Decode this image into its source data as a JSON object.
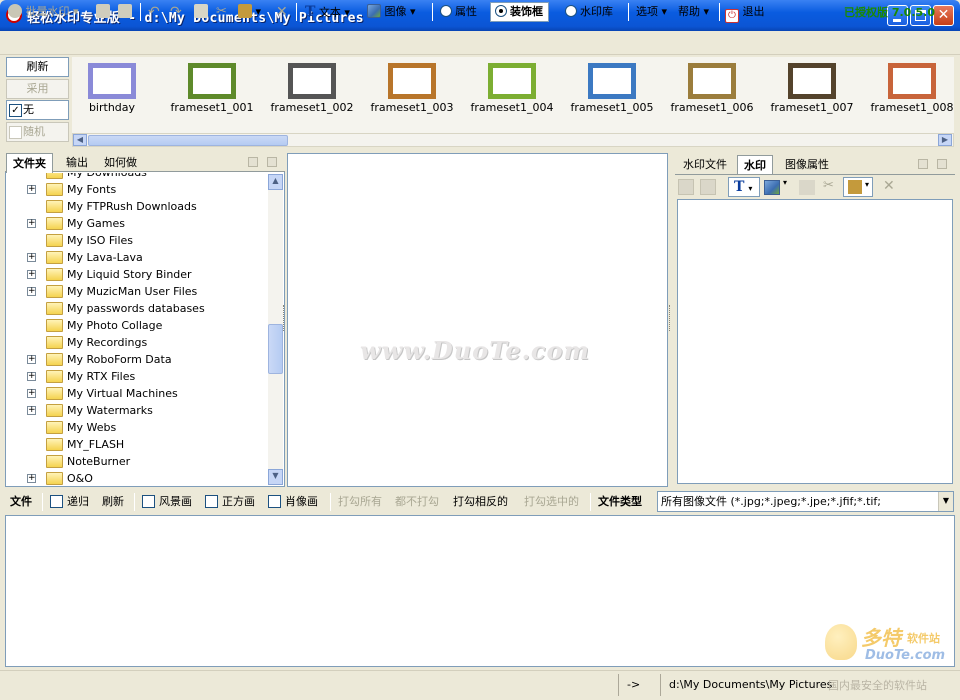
{
  "window": {
    "title": "轻松水印专业版 - d:\\My Documents\\My Pictures",
    "icon": "app-logo-icon"
  },
  "toolbar": {
    "batch_watermark": "批量水印",
    "text": "文本",
    "image": "图像",
    "properties": "属性",
    "decoration_frame": "装饰框",
    "watermark_lib": "水印库",
    "options": "选项",
    "help": "帮助",
    "exit": "退出",
    "license": "已授权版 7.0.5.0",
    "active_mode": "decoration_frame"
  },
  "gallery": {
    "refresh": "刷新",
    "apply": "采用",
    "none": "无",
    "none_checked": true,
    "random": "随机",
    "random_checked": false,
    "frames": [
      {
        "label": "birthday",
        "color": "#8a8ad8"
      },
      {
        "label": "frameset1_001",
        "color": "#5e8a2a"
      },
      {
        "label": "frameset1_002",
        "color": "#555555"
      },
      {
        "label": "frameset1_003",
        "color": "#b8752a"
      },
      {
        "label": "frameset1_004",
        "color": "#7cae32"
      },
      {
        "label": "frameset1_005",
        "color": "#3c79c2"
      },
      {
        "label": "frameset1_006",
        "color": "#9b7d3c"
      },
      {
        "label": "frameset1_007",
        "color": "#54432c"
      },
      {
        "label": "frameset1_008",
        "color": "#c8643a"
      }
    ]
  },
  "left_panel": {
    "tabs": [
      "文件夹",
      "输出",
      "如何做"
    ],
    "active_tab": 0,
    "tree": [
      {
        "label": "My Downloads",
        "expandable": false
      },
      {
        "label": "My Fonts",
        "expandable": true
      },
      {
        "label": "My FTPRush Downloads",
        "expandable": false
      },
      {
        "label": "My Games",
        "expandable": true
      },
      {
        "label": "My ISO Files",
        "expandable": false
      },
      {
        "label": "My Lava-Lava",
        "expandable": true
      },
      {
        "label": "My Liquid Story Binder",
        "expandable": true
      },
      {
        "label": "My MuzicMan User Files",
        "expandable": true
      },
      {
        "label": "My passwords databases",
        "expandable": false
      },
      {
        "label": "My Photo Collage",
        "expandable": false
      },
      {
        "label": "My Recordings",
        "expandable": false
      },
      {
        "label": "My RoboForm Data",
        "expandable": true
      },
      {
        "label": "My RTX Files",
        "expandable": true
      },
      {
        "label": "My Virtual Machines",
        "expandable": true
      },
      {
        "label": "My Watermarks",
        "expandable": true
      },
      {
        "label": "My Webs",
        "expandable": false
      },
      {
        "label": "MY_FLASH",
        "expandable": false
      },
      {
        "label": "NoteBurner",
        "expandable": false
      },
      {
        "label": "O&O",
        "expandable": true
      }
    ]
  },
  "center": {
    "watermark_text": "www.DuoTe.com"
  },
  "right_panel": {
    "tabs": [
      "水印文件",
      "水印",
      "图像属性"
    ],
    "active_tab": 1
  },
  "filter_bar": {
    "file": "文件",
    "recurse": "递归",
    "refresh": "刷新",
    "landscape": "风景画",
    "square": "正方画",
    "portrait": "肖像画",
    "check_all": "打勾所有",
    "uncheck_all": "都不打勾",
    "invert_check": "打勾相反的",
    "check_selected": "打勾选中的",
    "file_type_label": "文件类型",
    "file_type_value": "所有图像文件 (*.jpg;*.jpeg;*.jpe;*.jfif;*.tif;"
  },
  "status": {
    "arrow": "->",
    "path": "d:\\My Documents\\My Pictures"
  },
  "logo_watermark": {
    "brand": "多特",
    "sub": "软件站",
    "url": "DuoTe.com",
    "slogan": "国内最安全的软件站"
  }
}
